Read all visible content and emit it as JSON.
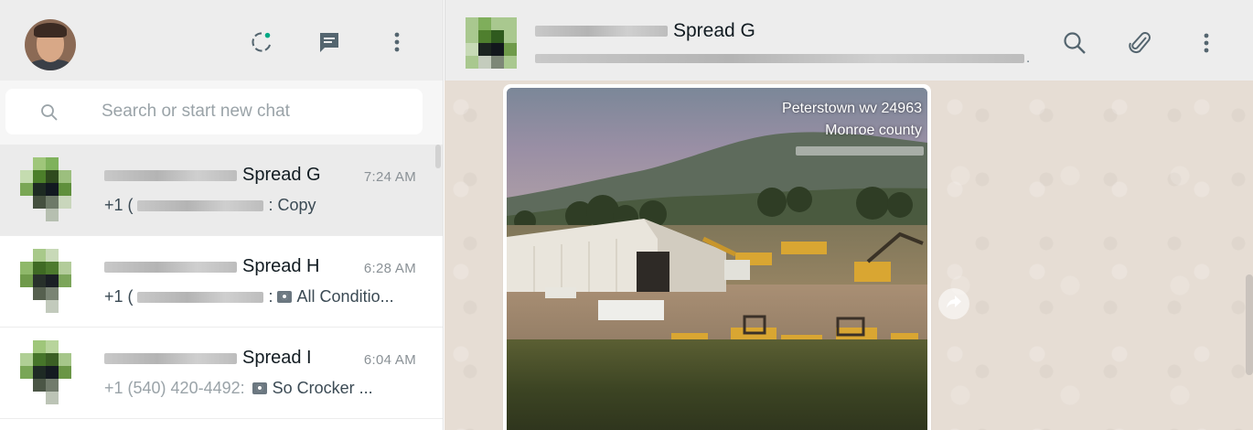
{
  "sidebar": {
    "search": {
      "placeholder": "Search or start new chat"
    },
    "chats": [
      {
        "name": "Spread G",
        "time": "7:24 AM",
        "prefix": "+1 (",
        "message": ": Copy",
        "has_photo": false
      },
      {
        "name": "Spread H",
        "time": "6:28 AM",
        "prefix": "+1 (",
        "message": "All Conditio...",
        "has_photo": true
      },
      {
        "name": "Spread I",
        "time": "6:04 AM",
        "prefix": "+1 (540) 420-4492:",
        "message": "So Crocker ...",
        "has_photo": true
      }
    ],
    "icons": [
      "status-icon",
      "new-chat-icon",
      "menu-icon"
    ]
  },
  "conversation": {
    "title": "Spread G",
    "subtitle": ".",
    "icons": [
      "search-icon",
      "attach-icon",
      "menu-icon"
    ],
    "photo_stamp": {
      "line1": "Peterstown wv 24963",
      "line2": "Monroe county"
    }
  },
  "colors": {
    "header_bg": "#ededed",
    "active_chat_bg": "#ebebeb",
    "chat_wallpaper": "#e6ddd4",
    "status_dot": "#00a884"
  }
}
